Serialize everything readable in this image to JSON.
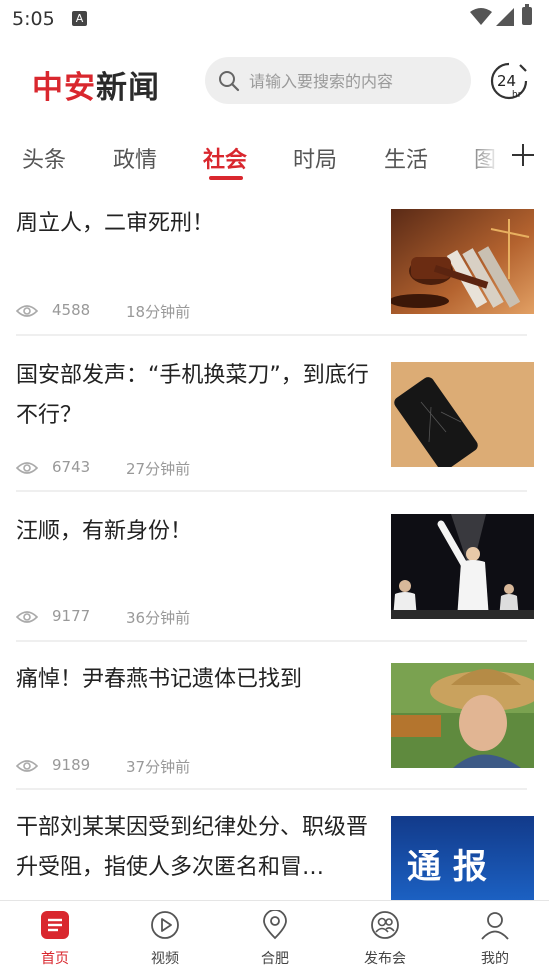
{
  "status_bar": {
    "time": "5:05",
    "notification_glyph": "A"
  },
  "header": {
    "logo_part1": "中安",
    "logo_part2": "新闻",
    "search_placeholder": "请输入要搜索的内容",
    "badge_24": "24",
    "badge_hr": "hr"
  },
  "tabs": [
    {
      "label": "头条",
      "active": false
    },
    {
      "label": "政情",
      "active": false
    },
    {
      "label": "社会",
      "active": true
    },
    {
      "label": "时局",
      "active": false
    },
    {
      "label": "生活",
      "active": false
    },
    {
      "label": "图",
      "active": false
    }
  ],
  "articles": [
    {
      "title": "周立人，二审死刑！",
      "views": "4588",
      "time_ago": "18分钟前",
      "thumb": "gavel"
    },
    {
      "title": "国安部发声：“手机换菜刀”，到底行不行？",
      "views": "6743",
      "time_ago": "27分钟前",
      "thumb": "phone"
    },
    {
      "title": "汪顺，有新身份！",
      "views": "9177",
      "time_ago": "36分钟前",
      "thumb": "athlete"
    },
    {
      "title": "痛悼！尹春燕书记遗体已找到",
      "views": "9189",
      "time_ago": "37分钟前",
      "thumb": "portrait"
    },
    {
      "title": "干部刘某某因受到纪律处分、职级晋升受阻，指使人多次匿名和冒…",
      "views": "",
      "time_ago": "",
      "thumb": "notice",
      "thumb_text": "通 报"
    }
  ],
  "bottom_nav": [
    {
      "label": "首页",
      "icon": "home-news-icon",
      "active": true
    },
    {
      "label": "视频",
      "icon": "play-circle-icon",
      "active": false
    },
    {
      "label": "合肥",
      "icon": "location-pin-icon",
      "active": false
    },
    {
      "label": "发布会",
      "icon": "people-circle-icon",
      "active": false
    },
    {
      "label": "我的",
      "icon": "user-icon",
      "active": false
    }
  ],
  "colors": {
    "accent": "#d9272e",
    "text": "#222222",
    "muted": "#999999"
  }
}
